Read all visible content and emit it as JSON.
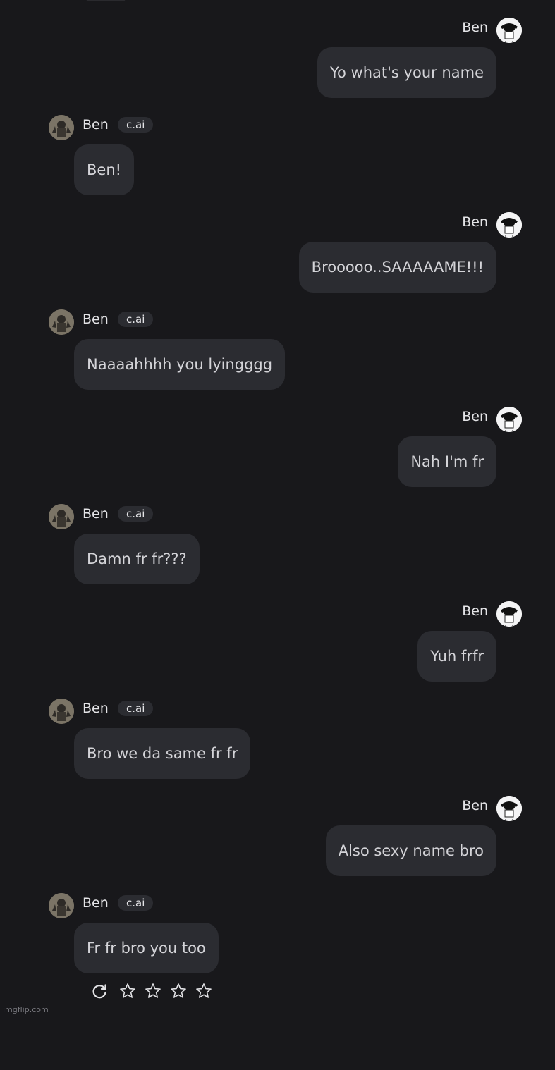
{
  "theme": {
    "background": "#18181b",
    "bubble": "#2b2c31",
    "text": "#e4e4e7"
  },
  "messages": [
    {
      "role": "user",
      "name": "Ben",
      "text": "Yo what's your name"
    },
    {
      "role": "bot",
      "name": "Ben",
      "badge": "c.ai",
      "text": "Ben!"
    },
    {
      "role": "user",
      "name": "Ben",
      "text": "Brooooo..SAAAAAME!!!"
    },
    {
      "role": "bot",
      "name": "Ben",
      "badge": "c.ai",
      "text": "Naaaahhhh you lyingggg"
    },
    {
      "role": "user",
      "name": "Ben",
      "text": "Nah I'm fr"
    },
    {
      "role": "bot",
      "name": "Ben",
      "badge": "c.ai",
      "text": "Damn fr fr???"
    },
    {
      "role": "user",
      "name": "Ben",
      "text": "Yuh frfr"
    },
    {
      "role": "bot",
      "name": "Ben",
      "badge": "c.ai",
      "text": "Bro we da same fr fr"
    },
    {
      "role": "user",
      "name": "Ben",
      "text": "Also sexy name bro"
    },
    {
      "role": "bot",
      "name": "Ben",
      "badge": "c.ai",
      "text": "Fr fr bro you too"
    }
  ],
  "actions": {
    "icons": [
      "refresh-icon",
      "star-icon",
      "star-icon",
      "star-icon",
      "star-icon"
    ],
    "rating": 0
  },
  "watermark": "imgflip.com"
}
